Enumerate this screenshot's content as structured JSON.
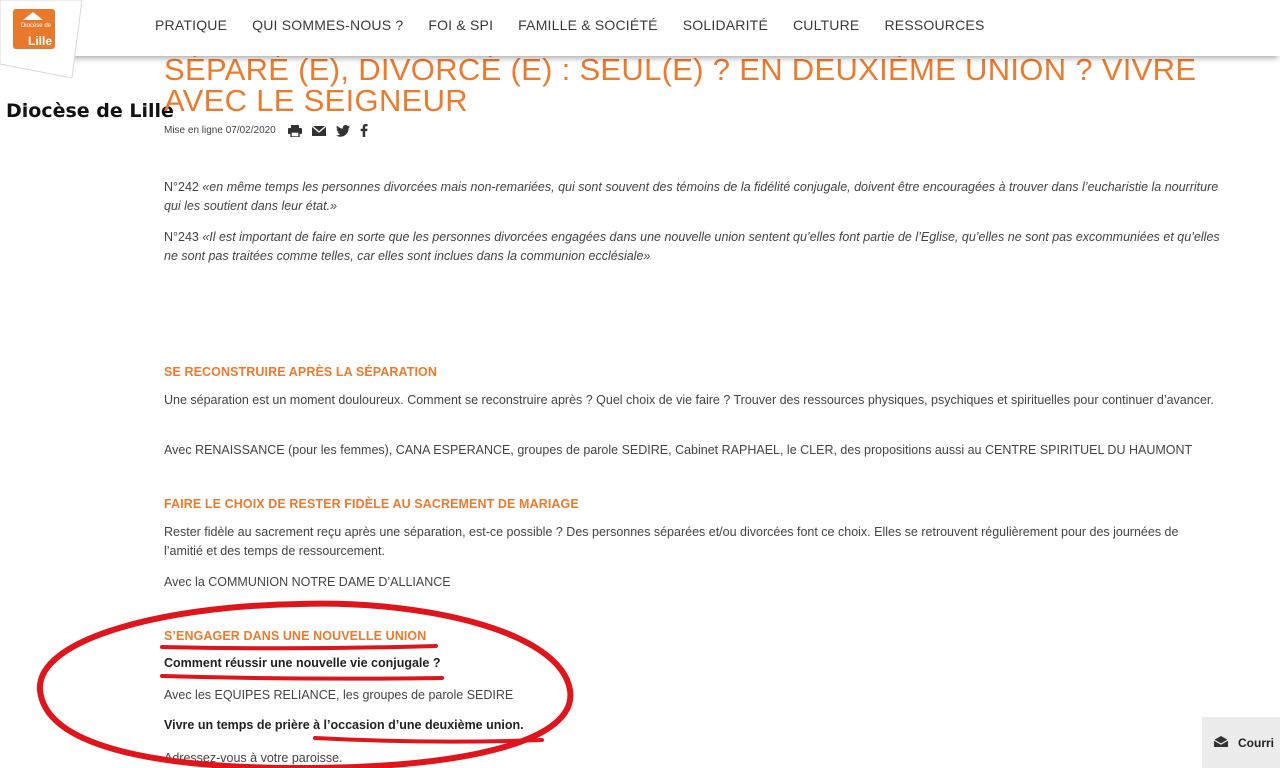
{
  "logo": {
    "small": "Diocèse de",
    "big": "Lille"
  },
  "site_name": "Diocèse de Lille",
  "nav": [
    "PRATIQUE",
    "QUI SOMMES-NOUS ?",
    "FOI & SPI",
    "FAMILLE & SOCIÉTÉ",
    "SOLIDARITÉ",
    "CULTURE",
    "RESSOURCES"
  ],
  "article": {
    "title": "SÉPARÉ (E), DIVORCÉ (E) : SEUL(E) ? EN DEUXIÈME UNION ? VIVRE AVEC LE SEIGNEUR",
    "date": "Mise en ligne 07/02/2020",
    "share_icons": [
      "print-icon",
      "mail-icon",
      "twitter-icon",
      "facebook-icon"
    ],
    "p242_num": "N°242 ",
    "p242_text": "«en même temps les personnes divorcées mais non-remariées, qui sont souvent des témoins de la fidélité conjugale, doivent être encouragées à trouver dans l’eucharistie la nourriture qui les soutient dans leur état.»",
    "p243_num": "N°243 ",
    "p243_text": "«Il est important de faire en sorte que les personnes divorcées engagées dans une nouvelle union sentent qu’elles font partie de l’Eglise, qu’elles ne sont pas excommuniées et qu’elles ne sont pas traitées comme telles, car elles sont inclues dans la communion ecclésiale»",
    "sections": {
      "s1_title": "SE RECONSTRUIRE APRÈS LA SÉPARATION",
      "s1_p1": "Une séparation est un moment douloureux. Comment se reconstruire après ? Quel choix de vie faire ? Trouver des ressources physiques, psychiques et spirituelles pour continuer d’avancer.",
      "s1_p2": "Avec RENAISSANCE (pour les femmes), CANA ESPERANCE, groupes de parole SEDIRE, Cabinet RAPHAEL, le CLER, des propositions aussi au CENTRE SPIRITUEL DU HAUMONT",
      "s2_title": "FAIRE LE CHOIX DE RESTER FIDÈLE AU SACREMENT DE MARIAGE",
      "s2_p1": "Rester fidèle au sacrement reçu après une séparation, est-ce possible ? Des personnes séparées et/ou divorcées font ce choix. Elles se retrouvent régulièrement pour des journées de l’amitié et des temps de ressourcement.",
      "s2_p2": "Avec la COMMUNION NOTRE DAME D’ALLIANCE",
      "s3_title": "S’ENGAGER DANS UNE NOUVELLE UNION",
      "s3_q1": "Comment réussir une nouvelle vie conjugale ?",
      "s3_p1": "Avec les EQUIPES RELIANCE, les groupes de parole SEDIRE",
      "s3_q2": "Vivre un temps de prière à l’occasion d’une deuxième union.",
      "s3_p2": "Adressez-vous à votre paroisse."
    }
  },
  "mail_tab": {
    "label": "Courri"
  },
  "colors": {
    "accent": "#ec7b2e",
    "annotation": "#e0151c"
  }
}
